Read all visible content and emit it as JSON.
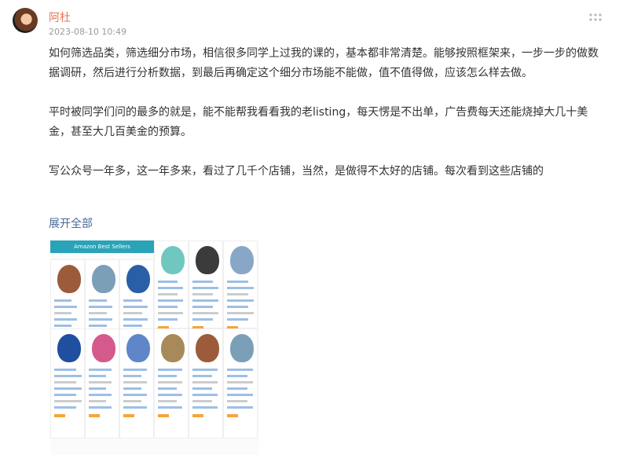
{
  "author": {
    "name": "阿杜",
    "timestamp": "2023-08-10 10:49"
  },
  "menu": {
    "icon": "more-dots-icon"
  },
  "content": {
    "paragraphs": [
      "如何筛选品类，筛选细分市场，相信很多同学上过我的课的，基本都非常清楚。能够按照框架来，一步一步的做数据调研，然后进行分析数据，到最后再确定这个细分市场能不能做，值不值得做，应该怎么样去做。",
      "平时被同学们问的最多的就是，能不能帮我看看我的老listing，每天愣是不出单，广告费每天还能烧掉大几十美金，甚至大几百美金的预算。",
      "写公众号一年多，这一年多来，看过了几千个店铺，当然，是做得不太好的店铺。每次看到这些店铺的"
    ],
    "expand_label": "展开全部"
  },
  "image": {
    "header_text": "Amazon Best Sellers",
    "colors": {
      "header": "#2aa3b8",
      "link": "#4a6a97",
      "author": "#eb7350"
    }
  }
}
